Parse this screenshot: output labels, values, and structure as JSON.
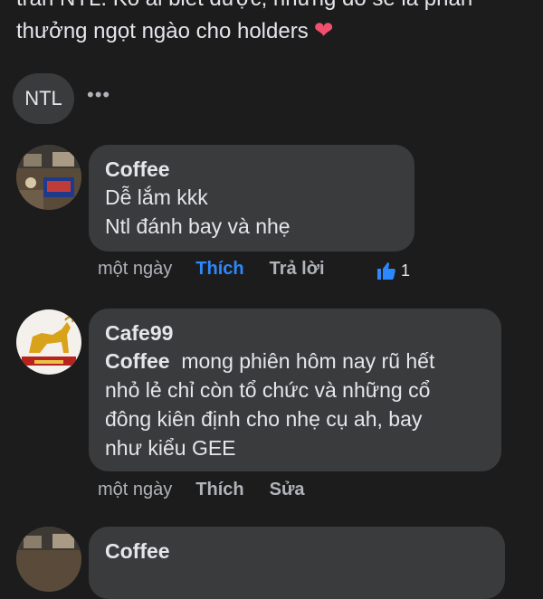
{
  "post": {
    "text_line1": "trần NTL. Ko ai biết được, nhưng đó sẽ là phần",
    "text_line2": "thưởng ngọt ngào cho holders",
    "emoji": "❤"
  },
  "tag_chip": {
    "label": "NTL"
  },
  "more_menu": {
    "icon": "more-dots-icon",
    "label": "•••"
  },
  "comments": [
    {
      "author": "Coffee",
      "lines": [
        "Dễ lắm kkk",
        "Ntl đánh bay và nhẹ"
      ],
      "time": "một ngày",
      "like_label": "Thích",
      "reply_label": "Trả lời",
      "like_count": "1",
      "liked": true
    },
    {
      "author": "Cafe99",
      "mention": "Coffee",
      "lines": [
        "mong phiên hôm nay rũ hết",
        "nhỏ lẻ chỉ còn tổ chức và những cổ",
        "đông kiên định cho nhẹ cụ ah, bay",
        "như kiểu GEE"
      ],
      "time": "một ngày",
      "like_label": "Thích",
      "edit_label": "Sửa"
    },
    {
      "author": "Coffee"
    }
  ],
  "colors": {
    "background": "#1c1c1d",
    "bubble": "#3a3b3c",
    "accent": "#2d88ff",
    "heart": "#f0506e"
  }
}
